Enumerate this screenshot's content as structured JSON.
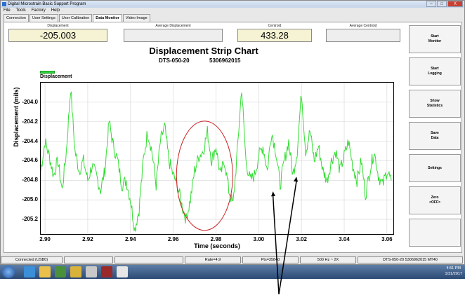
{
  "window": {
    "title": "Digital Microstrain Basic Support Program",
    "controls": [
      "–",
      "□",
      "X"
    ]
  },
  "menu": [
    "File",
    "Tools",
    "Factory",
    "Help"
  ],
  "tabs": [
    "Connection",
    "User Settings",
    "User Calibration",
    "Data Monitor",
    "Video Image"
  ],
  "active_tab": "Data Monitor",
  "readouts": {
    "displacement_label": "Displacement",
    "displacement_value": "-205.003",
    "avg_displacement_label": "Average Displacement",
    "centroid_label": "Centroid",
    "centroid_value": "433.28",
    "avg_centroid_label": "Average Centroid"
  },
  "side_buttons": [
    "Start\nMonitor",
    "Start\nLogging",
    "Show\nStatistics",
    "Save\nData",
    "Settings",
    "Zero\n<OFF>",
    ""
  ],
  "status": [
    "Connected (USB0)",
    "",
    "",
    "Rate=4.9",
    "Pts=35840",
    "500 Hz ~ 2X",
    "DTS-050-20  5306962015  MT40"
  ],
  "tray": {
    "time": "4:51 PM",
    "date": "1/31/2017"
  },
  "chart_data": {
    "type": "line",
    "title": "Displacement Strip Chart",
    "subtitle_left": "DTS-050-20",
    "subtitle_right": "5306962015",
    "xlabel": "Time (seconds)",
    "ylabel": "Displacement (mils)",
    "xlim": [
      2.898,
      3.063
    ],
    "ylim": [
      -205.35,
      -203.8
    ],
    "x_ticks": [
      2.9,
      2.92,
      2.94,
      2.96,
      2.98,
      3.0,
      3.02,
      3.04,
      3.06
    ],
    "x_tick_labels": [
      "2.90",
      "2.92",
      "2.94",
      "2.96",
      "2.98",
      "3.00",
      "3.02",
      "3.04",
      "3.06"
    ],
    "y_ticks": [
      -204.0,
      -204.2,
      -204.4,
      -204.6,
      -204.8,
      -205.0,
      -205.2
    ],
    "y_tick_labels": [
      "-204.0",
      "-204.2",
      "-204.4",
      "-204.6",
      "-204.8",
      "-205.0",
      "-205.2"
    ],
    "legend": "top-left",
    "grid": true,
    "series": [
      {
        "name": "Displacement",
        "color": "#33dd33",
        "x": [
          2.898,
          2.9,
          2.902,
          2.904,
          2.906,
          2.908,
          2.91,
          2.912,
          2.914,
          2.916,
          2.918,
          2.92,
          2.922,
          2.924,
          2.926,
          2.928,
          2.93,
          2.932,
          2.934,
          2.936,
          2.938,
          2.94,
          2.942,
          2.944,
          2.946,
          2.948,
          2.95,
          2.952,
          2.954,
          2.956,
          2.958,
          2.96,
          2.962,
          2.964,
          2.966,
          2.968,
          2.97,
          2.972,
          2.974,
          2.976,
          2.978,
          2.98,
          2.982,
          2.984,
          2.986,
          2.988,
          2.99,
          2.992,
          2.994,
          2.996,
          2.998,
          3.0,
          3.002,
          3.004,
          3.006,
          3.008,
          3.01,
          3.012,
          3.014,
          3.016,
          3.018,
          3.02,
          3.022,
          3.024,
          3.026,
          3.028,
          3.03,
          3.032,
          3.034,
          3.036,
          3.038,
          3.04,
          3.042,
          3.044,
          3.046,
          3.048,
          3.05,
          3.052,
          3.054,
          3.056,
          3.058,
          3.06,
          3.062
        ],
        "y": [
          -204.7,
          -204.4,
          -204.55,
          -204.75,
          -204.6,
          -204.9,
          -204.5,
          -203.85,
          -204.5,
          -204.7,
          -204.6,
          -204.8,
          -204.65,
          -204.75,
          -204.9,
          -204.7,
          -204.2,
          -204.45,
          -204.6,
          -204.85,
          -204.8,
          -205.0,
          -205.3,
          -205.1,
          -204.6,
          -204.3,
          -204.5,
          -204.85,
          -204.4,
          -204.25,
          -204.6,
          -204.75,
          -204.85,
          -205.05,
          -205.2,
          -205.0,
          -204.7,
          -204.55,
          -204.5,
          -204.3,
          -204.6,
          -204.45,
          -204.75,
          -204.6,
          -204.9,
          -205.05,
          -204.5,
          -203.85,
          -204.6,
          -204.8,
          -204.75,
          -204.55,
          -204.45,
          -204.7,
          -204.3,
          -204.5,
          -204.85,
          -204.6,
          -204.4,
          -204.75,
          -204.5,
          -203.9,
          -204.5,
          -204.3,
          -204.6,
          -204.45,
          -204.7,
          -204.8,
          -204.6,
          -204.5,
          -204.7,
          -204.55,
          -204.4,
          -204.65,
          -204.8,
          -204.6,
          -204.95,
          -204.7,
          -204.5,
          -204.75,
          -204.85,
          -204.7,
          -204.8
        ]
      }
    ],
    "annotations": {
      "ellipse_center": [
        2.975,
        -204.76
      ],
      "arrow1_tip": [
        3.007,
        -204.92
      ],
      "arrow2_tip": [
        3.018,
        -204.77
      ]
    }
  }
}
